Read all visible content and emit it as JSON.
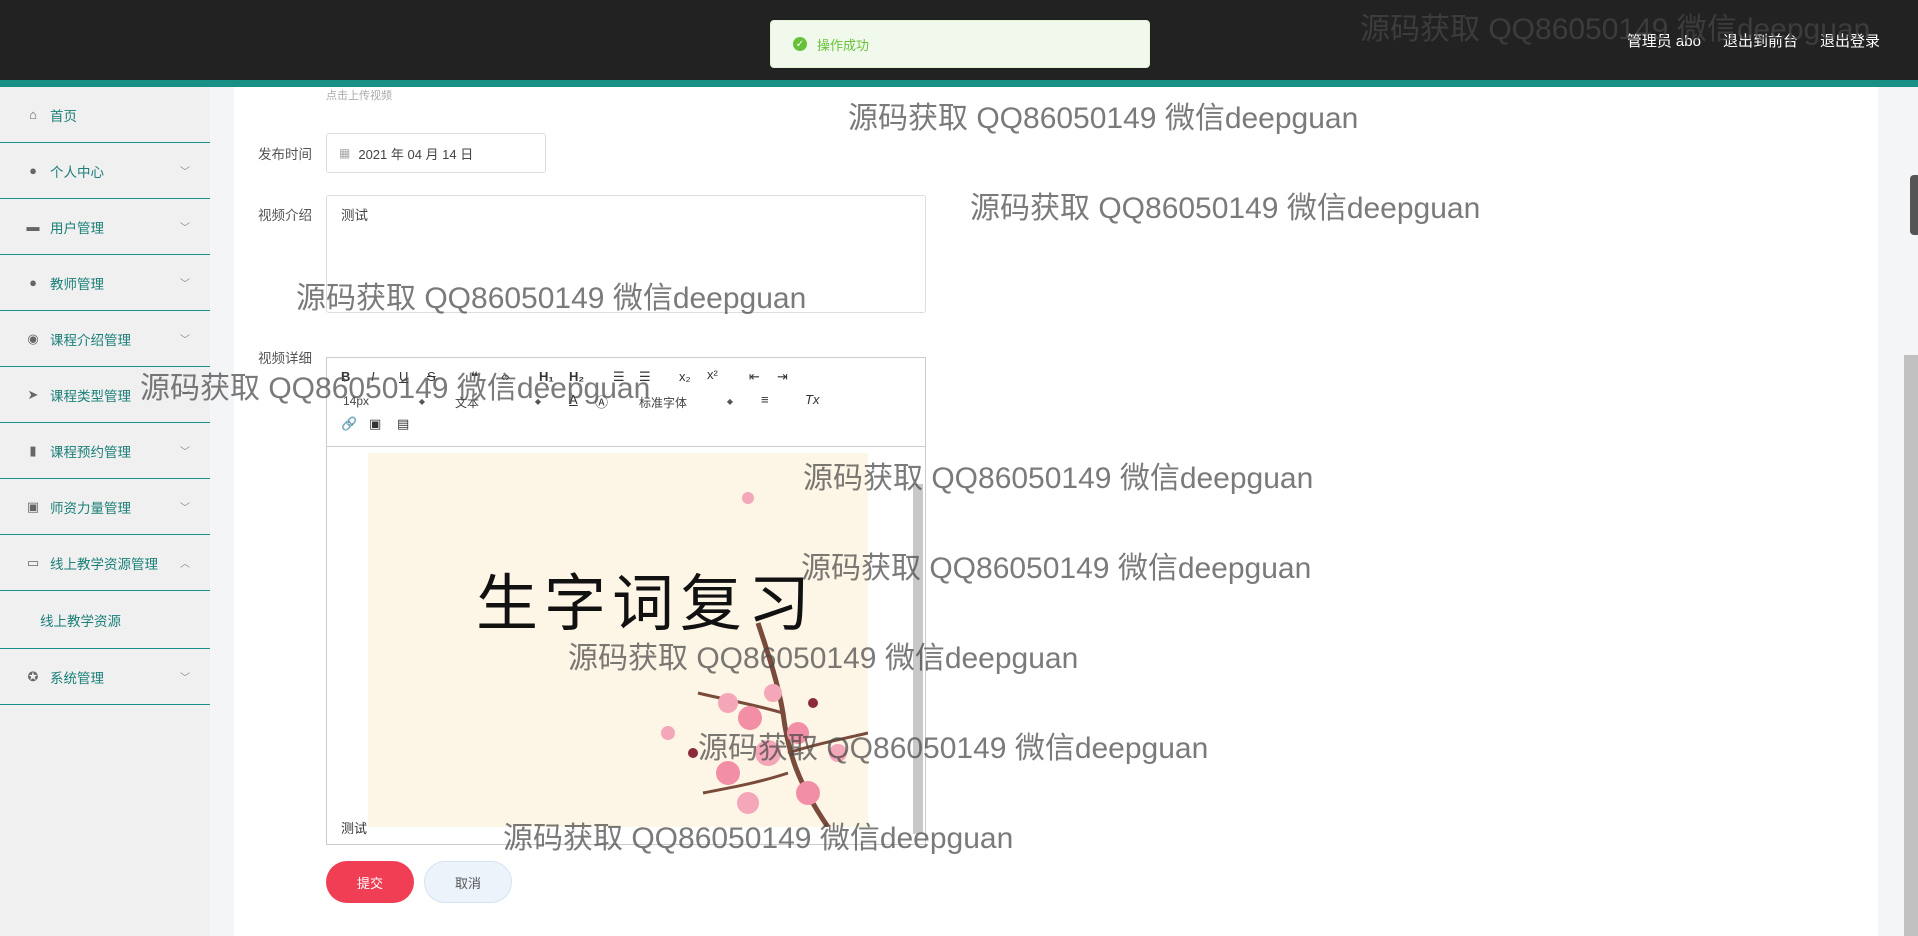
{
  "header": {
    "admin_label": "管理员 abo",
    "front_link": "退出到前台",
    "logout_link": "退出登录"
  },
  "toast": {
    "message": "操作成功",
    "icon": "check-circle-icon"
  },
  "sidebar": {
    "items": [
      {
        "label": "首页",
        "icon": "home-icon"
      },
      {
        "label": "个人中心",
        "icon": "user-icon"
      },
      {
        "label": "用户管理",
        "icon": "monitor-icon"
      },
      {
        "label": "教师管理",
        "icon": "user-icon"
      },
      {
        "label": "课程介绍管理",
        "icon": "bulb-icon"
      },
      {
        "label": "课程类型管理",
        "icon": "send-icon"
      },
      {
        "label": "课程预约管理",
        "icon": "bar-chart-icon"
      },
      {
        "label": "师资力量管理",
        "icon": "clipboard-icon"
      },
      {
        "label": "线上教学资源管理",
        "icon": "chat-icon",
        "expanded": true
      },
      {
        "label": "系统管理",
        "icon": "settings-icon"
      }
    ],
    "submenu_item": "线上教学资源"
  },
  "form": {
    "upload_hint": "点击上传视频",
    "publish_time_label": "发布时间",
    "publish_time_value": "2021 年 04 月 14 日",
    "intro_label": "视频介绍",
    "intro_value": "测试",
    "detail_label": "视频详细",
    "editor": {
      "font_size": "14px",
      "paragraph": "文本",
      "font_family": "标准字体",
      "image_text": "生字词复习",
      "caption": "测试"
    },
    "submit_label": "提交",
    "cancel_label": "取消"
  },
  "watermark": "源码获取 QQ86050149 微信deepguan",
  "colors": {
    "accent": "#1a8f86",
    "topbar": "#222222",
    "submit": "#f03e55",
    "success": "#67c23a"
  }
}
